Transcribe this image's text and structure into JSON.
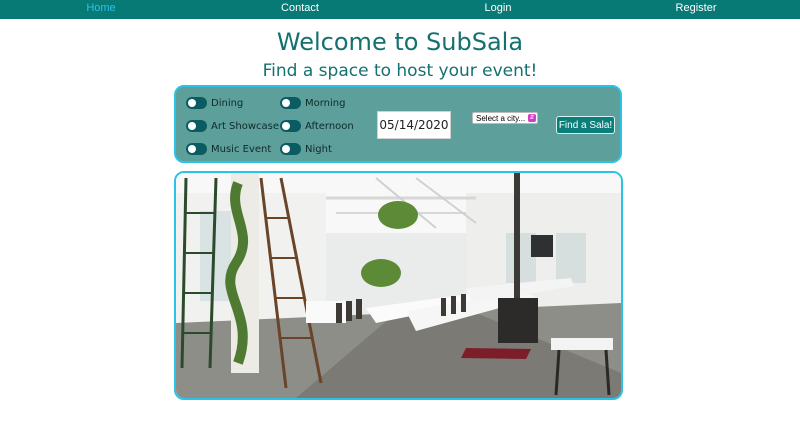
{
  "nav": {
    "items": [
      {
        "label": "Home",
        "active": true
      },
      {
        "label": "Contact",
        "active": false
      },
      {
        "label": "Login",
        "active": false
      },
      {
        "label": "Register",
        "active": false
      }
    ]
  },
  "header": {
    "title": "Welcome to SubSala",
    "subtitle": "Find a space to host your event!"
  },
  "search": {
    "event_types": [
      "Dining",
      "Art Showcase",
      "Music Event"
    ],
    "times": [
      "Morning",
      "Afternoon",
      "Night"
    ],
    "date_value": "05/14/2020",
    "city_placeholder": "Select a city...",
    "button_label": "Find a Sala!"
  },
  "hero": {
    "icon": "venue-photo"
  },
  "colors": {
    "nav_bg": "#087a76",
    "nav_active": "#2bc2e6",
    "title": "#14716f",
    "panel_bg": "#5c9f9b",
    "accent_border": "#2bc2e6",
    "toggle": "#0b5c62",
    "button": "#0a7f7a"
  }
}
